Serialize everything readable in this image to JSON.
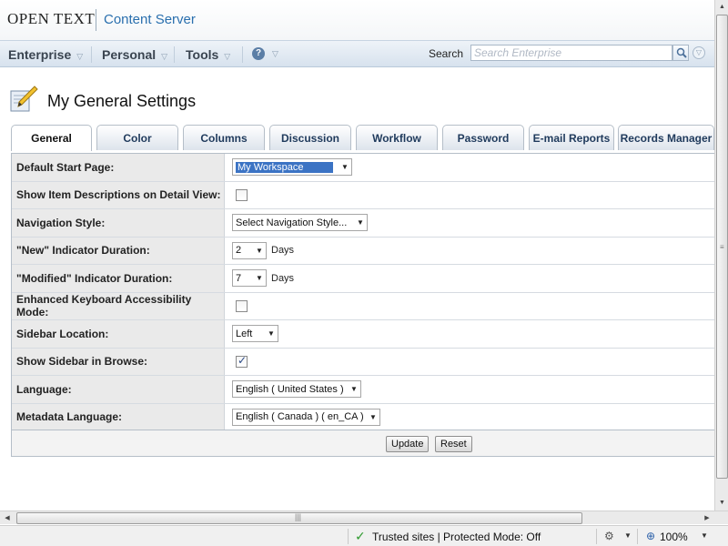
{
  "header": {
    "logo": "OPEN TEXT",
    "product": "Content Server"
  },
  "nav": {
    "items": [
      {
        "label": "Enterprise"
      },
      {
        "label": "Personal"
      },
      {
        "label": "Tools"
      }
    ],
    "help_symbol": "?",
    "search_label": "Search",
    "search_placeholder": "Search Enterprise"
  },
  "page": {
    "title": "My General Settings"
  },
  "tabs": [
    {
      "label": "General",
      "active": true
    },
    {
      "label": "Color"
    },
    {
      "label": "Columns"
    },
    {
      "label": "Discussion"
    },
    {
      "label": "Workflow"
    },
    {
      "label": "Password"
    },
    {
      "label": "E-mail Reports"
    },
    {
      "label": "Records Manager"
    }
  ],
  "form": {
    "rows": [
      {
        "label": "Default Start Page:",
        "type": "select",
        "value": "My Workspace",
        "highlight": true
      },
      {
        "label": "Show Item Descriptions on Detail View:",
        "type": "checkbox",
        "checked": false
      },
      {
        "label": "Navigation Style:",
        "type": "select",
        "value": "Select Navigation Style..."
      },
      {
        "label": "\"New\" Indicator Duration:",
        "type": "select",
        "value": "2",
        "unit": "Days"
      },
      {
        "label": "\"Modified\" Indicator Duration:",
        "type": "select",
        "value": "7",
        "unit": "Days"
      },
      {
        "label": "Enhanced Keyboard Accessibility Mode:",
        "type": "checkbox",
        "checked": false
      },
      {
        "label": "Sidebar Location:",
        "type": "select",
        "value": "Left"
      },
      {
        "label": "Show Sidebar in Browse:",
        "type": "checkbox",
        "checked": true
      },
      {
        "label": "Language:",
        "type": "select",
        "value": "English ( United States )"
      },
      {
        "label": "Metadata Language:",
        "type": "select",
        "value": "English ( Canada ) ( en_CA )"
      }
    ],
    "update_label": "Update",
    "reset_label": "Reset"
  },
  "statusbar": {
    "zone": "Trusted sites | Protected Mode: Off",
    "zoom": "100%"
  },
  "icons": {
    "nav_chevron": "chevron-down-icon",
    "help": "help-icon",
    "search": "magnifier-icon",
    "title": "pencil-edit-icon",
    "zone": "checkmark-icon",
    "zoom": "zoom-icon"
  },
  "colors": {
    "brand_blue": "#2a6fae",
    "tab_text": "#1f3a5c",
    "label_bg": "#eaeaea",
    "selection": "#3b73c4"
  }
}
